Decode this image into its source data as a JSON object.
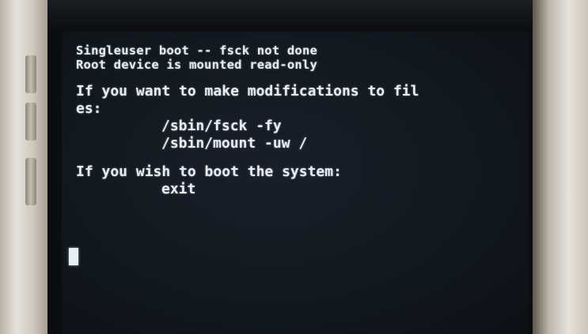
{
  "terminal": {
    "lines": [
      "Singleuser boot -- fsck not done",
      "Root device is mounted read-only",
      "If you want to make modifications to fil",
      "es:",
      "/sbin/fsck -fy",
      "/sbin/mount -uw /",
      "If you wish to boot the system:",
      "exit"
    ]
  },
  "colors": {
    "screen_background": "#131a22",
    "text": "#e6ecf2"
  }
}
